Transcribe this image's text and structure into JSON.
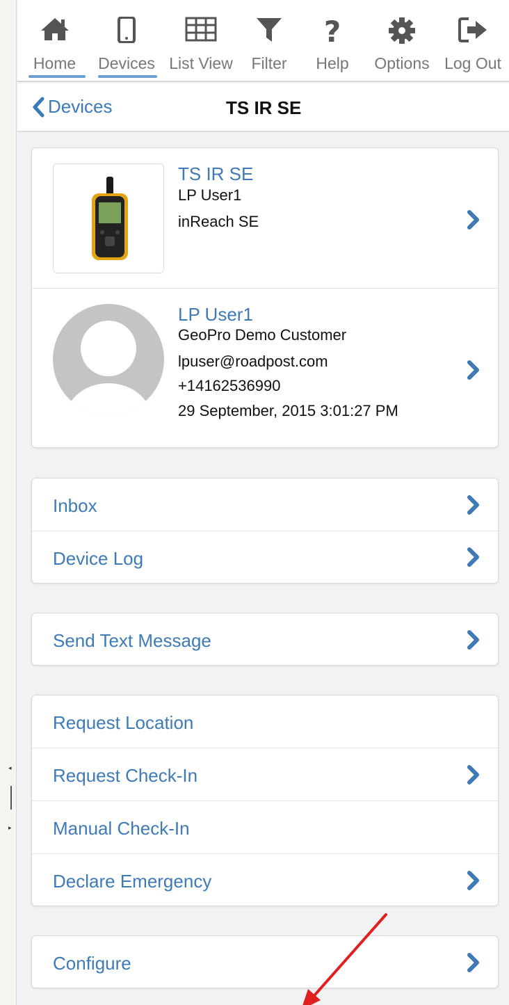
{
  "nav": {
    "items": [
      {
        "label": "Home",
        "icon": "home-icon",
        "underlined": true
      },
      {
        "label": "Devices",
        "icon": "phone-icon",
        "underlined": true
      },
      {
        "label": "List View",
        "icon": "grid-icon",
        "underlined": false
      },
      {
        "label": "Filter",
        "icon": "filter-icon",
        "underlined": false
      },
      {
        "label": "Help",
        "icon": "question-icon",
        "underlined": false
      },
      {
        "label": "Options",
        "icon": "gear-icon",
        "underlined": false
      },
      {
        "label": "Log Out",
        "icon": "logout-icon",
        "underlined": false
      }
    ]
  },
  "titlebar": {
    "back_label": "Devices",
    "title": "TS IR SE"
  },
  "device": {
    "name": "TS IR SE",
    "user": "LP User1",
    "model": "inReach SE"
  },
  "user": {
    "name": "LP User1",
    "company": "GeoPro Demo Customer",
    "email": "lpuser@roadpost.com",
    "phone": "+14162536990",
    "timestamp": "29 September, 2015 3:01:27 PM"
  },
  "messages_group": {
    "inbox": "Inbox",
    "device_log": "Device Log"
  },
  "send_group": {
    "send_text": "Send Text Message"
  },
  "actions_group": {
    "request_location": "Request Location",
    "request_checkin": "Request Check-In",
    "manual_checkin": "Manual Check-In",
    "declare_emergency": "Declare Emergency"
  },
  "configure_group": {
    "configure": "Configure"
  },
  "colors": {
    "link": "#3f7ab5",
    "nav_underline": "#6b9fd0",
    "annotation_arrow": "#e02020"
  }
}
